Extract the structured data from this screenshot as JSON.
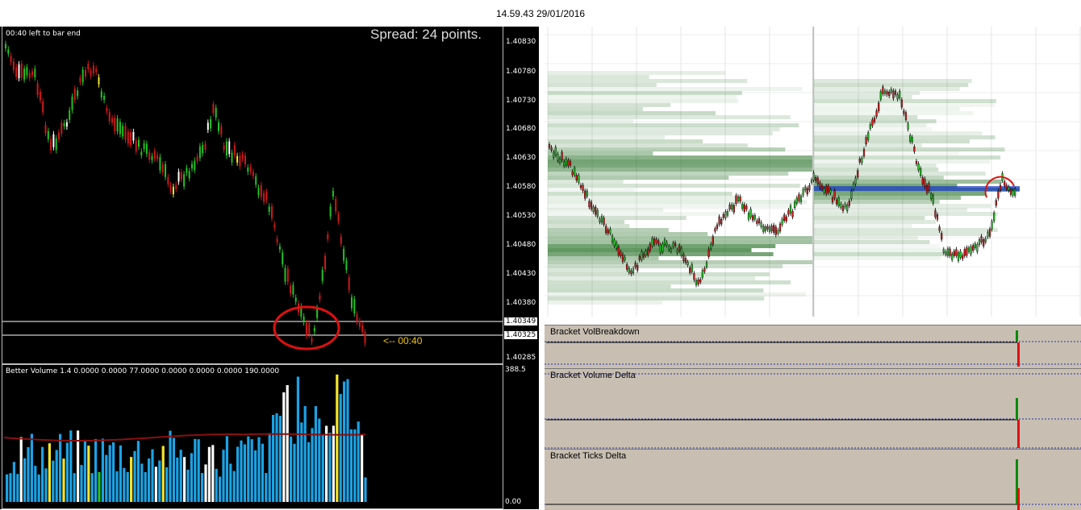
{
  "header": {
    "timestamp": "14.59.43 29/01/2016"
  },
  "left_chart": {
    "bar_timer": "00:40 left to bar end",
    "spread": "Spread: 24 points.",
    "countdown": "<-- 00:40",
    "y_ticks": [
      "1.40830",
      "1.40780",
      "1.40730",
      "1.40680",
      "1.40630",
      "1.40580",
      "1.40530",
      "1.40480",
      "1.40430",
      "1.40380",
      "1.40285"
    ],
    "price_labels": [
      "1.40349",
      "1.40325"
    ],
    "volume_title": "Better Volume 1.4 0.0000 0.0000 77.0000 0.0000 0.0000 0.0000 190.0000",
    "volume_max": "388.5",
    "volume_min": "0.00"
  },
  "right_chart": {
    "panel_titles": [
      "Bracket VolBreakdown",
      "Bracket Volume Delta",
      "Bracket Ticks Delta"
    ]
  },
  "colors": {
    "bull": "#22c422",
    "bear": "#d01818",
    "vol_blue": "#1aa3e6",
    "vol_yellow": "#f5e52a",
    "profile_green": "#1e6b1e",
    "profile_blue": "#1e3fc8",
    "panel_bg": "#c8bfb2"
  }
}
